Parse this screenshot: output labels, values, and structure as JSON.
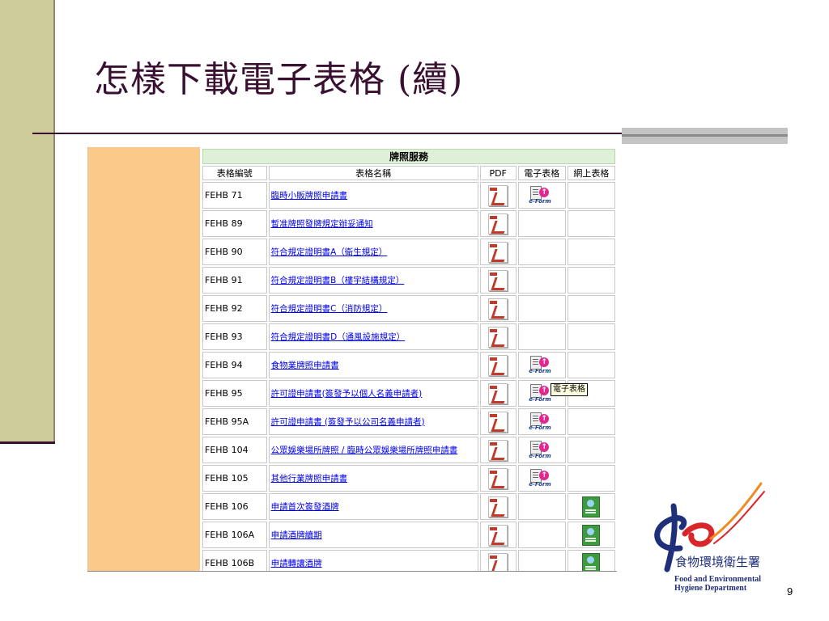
{
  "slide": {
    "title": "怎樣下載電子表格 (續)",
    "page_number": "9"
  },
  "table": {
    "caption": "牌照服務",
    "headers": [
      "表格編號",
      "表格名稱",
      "PDF",
      "電子表格",
      "網上表格"
    ],
    "rows": [
      {
        "code": "FEHB 71",
        "name": "臨時小販牌照申請書",
        "pdf": true,
        "eform": true,
        "online": false
      },
      {
        "code": "FEHB 89",
        "name": "暫准牌照發牌規定辦妥通知",
        "pdf": true,
        "eform": false,
        "online": false
      },
      {
        "code": "FEHB 90",
        "name": "符合規定證明書A（衛生規定）",
        "pdf": true,
        "eform": false,
        "online": false
      },
      {
        "code": "FEHB 91",
        "name": "符合規定證明書B（樓宇結構規定）",
        "pdf": true,
        "eform": false,
        "online": false
      },
      {
        "code": "FEHB 92",
        "name": "符合規定證明書C（消防規定）",
        "pdf": true,
        "eform": false,
        "online": false
      },
      {
        "code": "FEHB 93",
        "name": "符合規定證明書D（通風設施規定）",
        "pdf": true,
        "eform": false,
        "online": false
      },
      {
        "code": "FEHB 94",
        "name": "食物業牌照申請書",
        "pdf": true,
        "eform": true,
        "online": false
      },
      {
        "code": "FEHB 95",
        "name": "許可證申請書(簽發予以個人名義申請者)",
        "pdf": true,
        "eform": true,
        "online": false
      },
      {
        "code": "FEHB 95A",
        "name": "許可證申請書 (簽發予以公司名義申請者)",
        "pdf": true,
        "eform": true,
        "online": false
      },
      {
        "code": "FEHB 104",
        "name": "公眾娛樂場所牌照 / 臨時公眾娛樂場所牌照申請書",
        "pdf": true,
        "eform": true,
        "online": false
      },
      {
        "code": "FEHB 105",
        "name": "其他行業牌照申請書",
        "pdf": true,
        "eform": true,
        "online": false
      },
      {
        "code": "FEHB 106",
        "name": "申請首次簽發酒牌",
        "pdf": true,
        "eform": false,
        "online": true
      },
      {
        "code": "FEHB 106A",
        "name": "申請酒牌續期",
        "pdf": true,
        "eform": false,
        "online": true
      },
      {
        "code": "FEHB 106B",
        "name": "申請轉讓酒牌",
        "pdf": true,
        "eform": false,
        "online": true
      }
    ],
    "eform_label": "e-Form",
    "tooltip": "電子表格"
  },
  "logo": {
    "name_zh": "食物環境衛生署",
    "name_en_line1": "Food and Environmental",
    "name_en_line2": "Hygiene Department",
    "colors": {
      "blue": "#1f2f7a",
      "red": "#d8262a",
      "orange": "#f08a24"
    }
  },
  "colors": {
    "title": "#3a1030",
    "left_bar": "#cfcc9c",
    "sidebar": "#fbc989",
    "caption_bg": "#dff0d8",
    "link": "#0000ee"
  }
}
